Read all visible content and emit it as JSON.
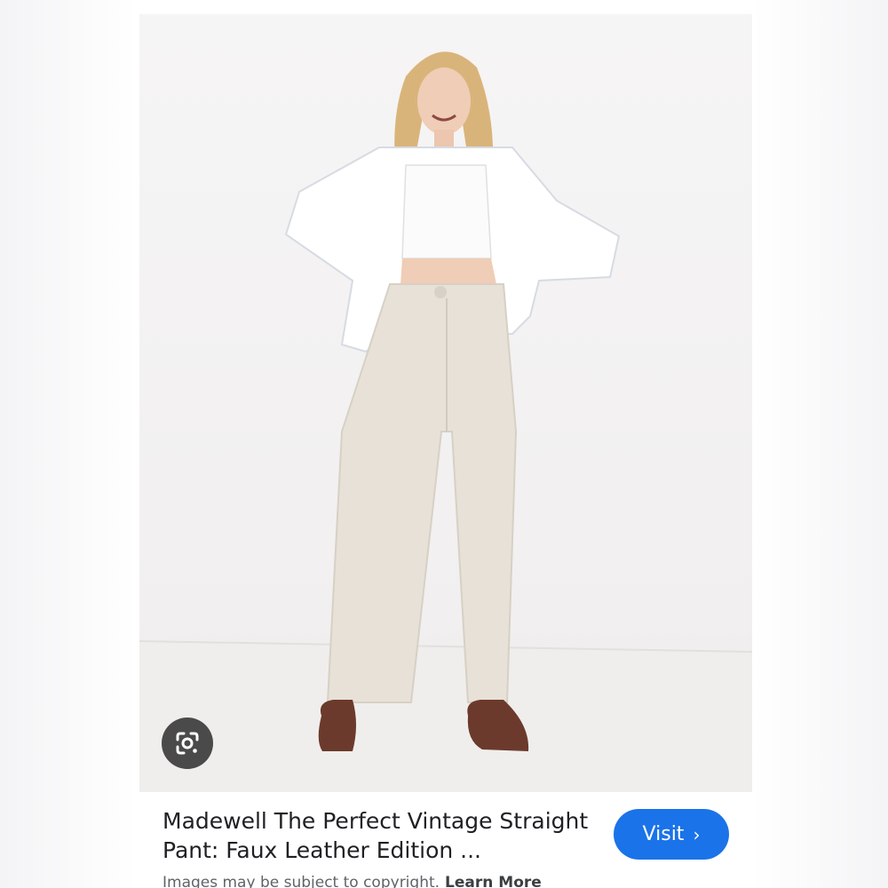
{
  "result": {
    "title": "Madewell The Perfect Vintage Straight Pant: Faux Leather Edition ...",
    "visit_label": "Visit",
    "visit_icon": "chevron-right-icon",
    "lens_icon": "google-lens-icon",
    "notice_text": "Images may be subject to copyright.",
    "learn_more_label": "Learn More"
  },
  "colors": {
    "visit_button": "#1a73e8",
    "lens_button": "#4a4a4a",
    "title_text": "#202124",
    "notice_text": "#5f6368"
  }
}
